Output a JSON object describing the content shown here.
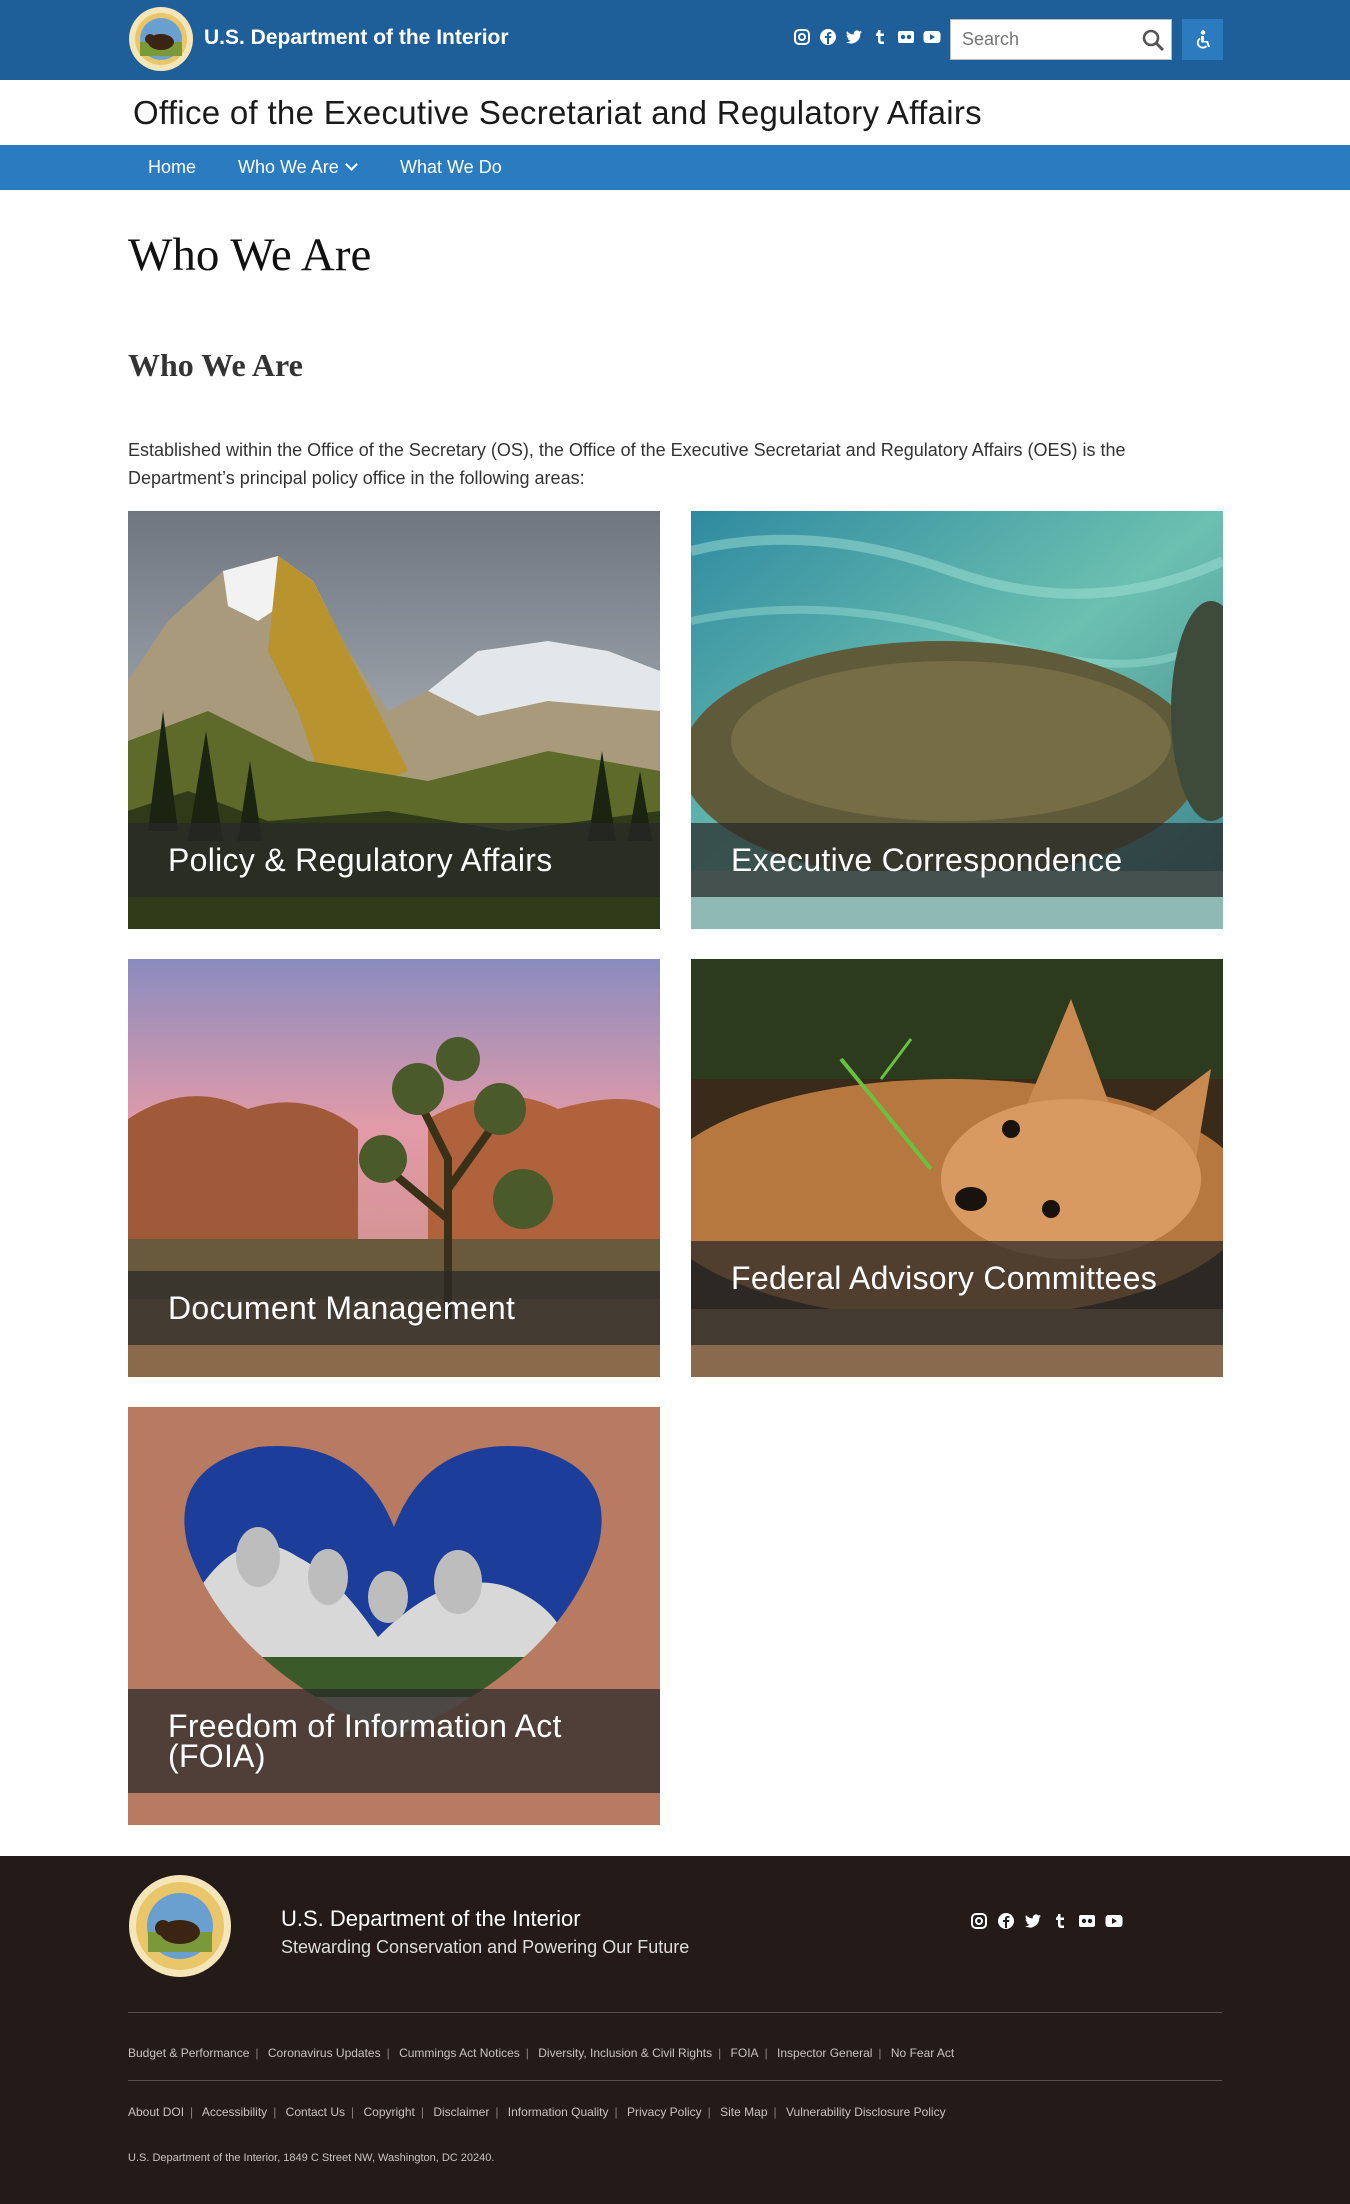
{
  "header": {
    "dept_name": "U.S. Department of the Interior",
    "search_placeholder": "Search",
    "social_icons": [
      "instagram-icon",
      "facebook-icon",
      "twitter-icon",
      "tumblr-icon",
      "flickr-icon",
      "youtube-icon"
    ],
    "colors": {
      "topbar": "#1e5f99",
      "nav": "#2a7bbf"
    }
  },
  "office": {
    "title": "Office of the Executive Secretariat and Regulatory Affairs"
  },
  "nav": {
    "home": "Home",
    "who_we_are": "Who We Are",
    "what_we_do": "What We Do"
  },
  "main": {
    "page_title": "Who We Are",
    "section_title": "Who We Are",
    "intro": "Established within the Office of the Secretary (OS), the Office of the Executive Secretariat and Regulatory Affairs (OES) is the Department’s principal policy office in the following areas:",
    "cards": [
      {
        "label": "Policy & Regulatory Affairs",
        "image": "mountain-landscape"
      },
      {
        "label": "Executive Correspondence",
        "image": "manatee-in-water"
      },
      {
        "label": "Document Management",
        "image": "joshua-tree-desert"
      },
      {
        "label": "Federal Advisory Committees",
        "image": "fox-kit"
      },
      {
        "label": "Freedom of Information Act (FOIA)",
        "image": "hands-heart-mount-rushmore"
      }
    ]
  },
  "footer": {
    "dept_name": "U.S. Department of the Interior",
    "tagline": "Stewarding Conservation and Powering Our Future",
    "links_row1": [
      "Budget & Performance",
      "Coronavirus Updates",
      "Cummings Act Notices",
      "Diversity, Inclusion & Civil Rights",
      "FOIA",
      "Inspector General",
      "No Fear Act"
    ],
    "links_row2": [
      "About DOI",
      "Accessibility",
      "Contact Us",
      "Copyright",
      "Disclaimer",
      "Information Quality",
      "Privacy Policy",
      "Site Map",
      "Vulnerability Disclosure Policy"
    ],
    "address": "U.S. Department of the Interior, 1849 C Street NW, Washington, DC 20240.",
    "background": "#241b18"
  }
}
